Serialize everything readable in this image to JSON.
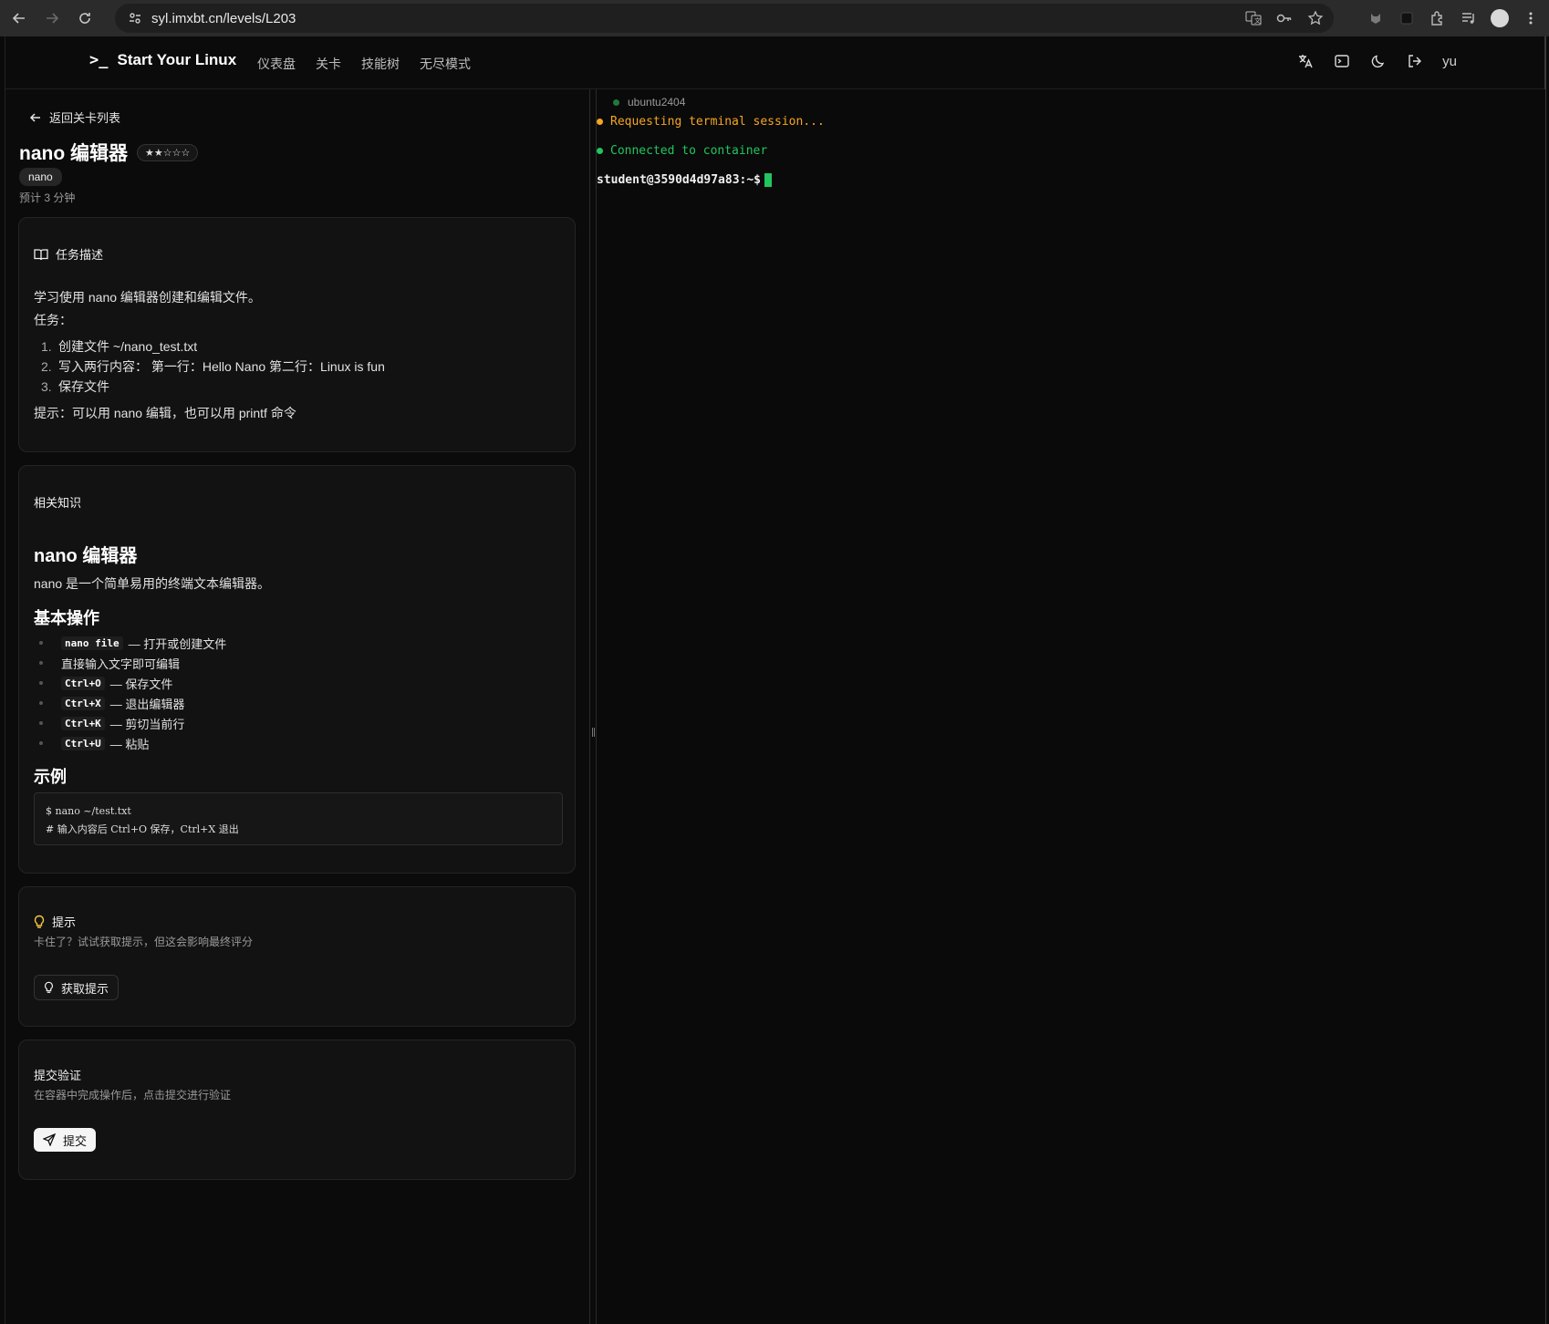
{
  "browser": {
    "url": "syl.imxbt.cn/levels/L203"
  },
  "topnav": {
    "brand_prompt": ">_",
    "brand_name": "Start Your Linux",
    "links": [
      "仪表盘",
      "关卡",
      "技能树",
      "无尽模式"
    ],
    "user": "yu"
  },
  "level": {
    "back_label": "返回关卡列表",
    "title": "nano 编辑器",
    "difficulty": "★★☆☆☆",
    "tag": "nano",
    "estimate": "预计 3 分钟"
  },
  "task": {
    "heading": "任务描述",
    "intro": "学习使用 nano 编辑器创建和编辑文件。",
    "tasks_label": "任务：",
    "steps": [
      {
        "n": "1.",
        "text": "创建文件 ~/nano_test.txt"
      },
      {
        "n": "2.",
        "text": "写入两行内容： 第一行：Hello Nano 第二行：Linux is fun"
      },
      {
        "n": "3.",
        "text": "保存文件"
      }
    ],
    "hint_line": "提示：可以用 nano 编辑，也可以用 printf 命令"
  },
  "knowledge": {
    "heading": "相关知识",
    "h2": "nano 编辑器",
    "p": "nano 是一个简单易用的终端文本编辑器。",
    "ops_heading": "基本操作",
    "ops": [
      {
        "key": "nano file",
        "text": "— 打开或创建文件"
      },
      {
        "key": "",
        "text": "直接输入文字即可编辑"
      },
      {
        "key": "Ctrl+O",
        "text": "— 保存文件"
      },
      {
        "key": "Ctrl+X",
        "text": "— 退出编辑器"
      },
      {
        "key": "Ctrl+K",
        "text": "— 剪切当前行"
      },
      {
        "key": "Ctrl+U",
        "text": "— 粘贴"
      }
    ],
    "example_heading": "示例",
    "code_lines": [
      "$ nano ~/test.txt",
      "# 输入内容后 Ctrl+O 保存，Ctrl+X 退出"
    ]
  },
  "hint": {
    "heading": "提示",
    "sub": "卡住了？试试获取提示，但这会影响最终评分",
    "button": "获取提示"
  },
  "submit": {
    "heading": "提交验证",
    "sub": "在容器中完成操作后，点击提交进行验证",
    "button": "提交"
  },
  "terminal": {
    "host": "ubuntu2404",
    "lines": [
      {
        "text": "Requesting terminal session...",
        "color": "#f5a524"
      },
      {
        "text": "Connected to container",
        "color": "#22c55e"
      }
    ],
    "prompt": "student@3590d4d97a83:~$"
  }
}
